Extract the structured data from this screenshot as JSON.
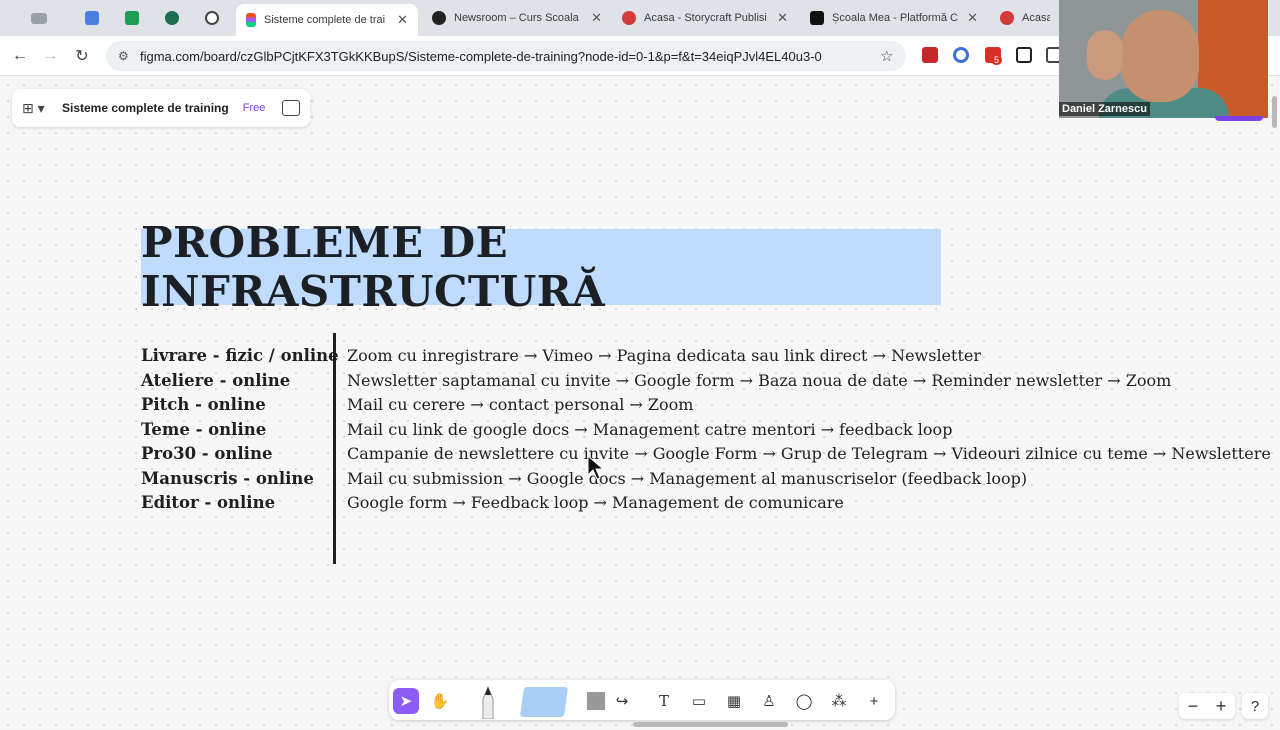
{
  "browser": {
    "tabs": [
      {
        "title": "Sisteme complete de trai",
        "icon": "figma-icon",
        "active": true
      },
      {
        "title": "Newsroom – Curs Scoala",
        "icon": "newsroom-icon",
        "active": false
      },
      {
        "title": "Acasa - Storycraft Publisi",
        "icon": "storycraft-icon",
        "active": false
      },
      {
        "title": "Școala Mea - Platformă C",
        "icon": "scoala-icon",
        "active": false
      },
      {
        "title": "Acasa -",
        "icon": "storycraft-icon",
        "active": false
      }
    ],
    "url": "figma.com/board/czGlbPCjtKFX3TGkKKBupS/Sisteme-complete-de-training?node-id=0-1&p=f&t=34eiqPJvl4EL40u3-0",
    "extension_badge": "5"
  },
  "figma": {
    "file_name": "Sisteme complete de training",
    "plan_badge": "Free"
  },
  "board": {
    "heading": "PROBLEME DE INFRASTRUCTURĂ",
    "rows": [
      {
        "label": "Livrare - fizic / online",
        "flow": "Zoom cu inregistrare → Vimeo → Pagina dedicata sau link direct → Newsletter"
      },
      {
        "label": "Ateliere - online",
        "flow": "Newsletter saptamanal cu invite → Google form → Baza noua de date → Reminder newsletter → Zoom"
      },
      {
        "label": "Pitch - online",
        "flow": "Mail cu cerere → contact personal → Zoom"
      },
      {
        "label": "Teme - online",
        "flow": "Mail cu link de google docs → Management catre mentori → feedback loop"
      },
      {
        "label": "Pro30 - online",
        "flow": "Campanie de newslettere cu invite → Google Form → Grup de Telegram → Videouri zilnice cu teme → Newslettere"
      },
      {
        "label": "Manuscris - online",
        "flow": "Mail cu submission → Google docs → Management al manuscriselor (feedback loop)"
      },
      {
        "label": "Editor - online",
        "flow": "Google form → Feedback loop → Management de comunicare"
      }
    ]
  },
  "webcam": {
    "name": "Daniel Zarnescu"
  },
  "colors": {
    "heading_bg": "#bfdcff",
    "accent": "#8b5cf6"
  }
}
